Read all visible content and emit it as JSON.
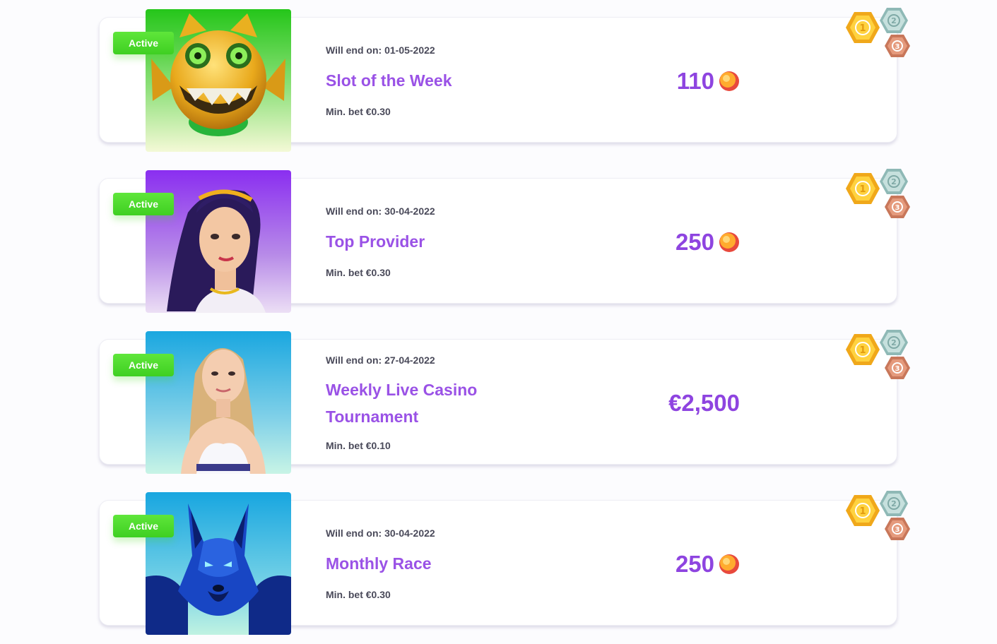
{
  "tournaments": [
    {
      "status": "Active",
      "end_text": "Will end on: 01-05-2022",
      "title_lines": [
        "Slot of the Week"
      ],
      "min_bet": "Min. bet €0.30",
      "prize": "110",
      "prize_icon": "orange-coin-icon",
      "thumb_icon": "robot-cat-game-art"
    },
    {
      "status": "Active",
      "end_text": "Will end on: 30-04-2022",
      "title_lines": [
        "Top Provider"
      ],
      "min_bet": "Min. bet €0.30",
      "prize": "250",
      "prize_icon": "orange-coin-icon",
      "thumb_icon": "goddess-game-art"
    },
    {
      "status": "Active",
      "end_text": "Will end on: 27-04-2022",
      "title_lines": [
        "Weekly Live Casino",
        "Tournament"
      ],
      "min_bet": "Min. bet €0.10",
      "prize": "€2,500",
      "prize_icon": "",
      "thumb_icon": "live-dealer-art"
    },
    {
      "status": "Active",
      "end_text": "Will end on: 30-04-2022",
      "title_lines": [
        "Monthly Race"
      ],
      "min_bet": "Min. bet €0.30",
      "prize": "250",
      "prize_icon": "orange-coin-icon",
      "thumb_icon": "blue-wolf-game-art"
    }
  ],
  "medals": {
    "first": "1",
    "second": "2",
    "third": "3"
  },
  "colors": {
    "accent": "#9a52e6",
    "active_badge": "#4cdc2c",
    "text": "#4a4a5a"
  }
}
